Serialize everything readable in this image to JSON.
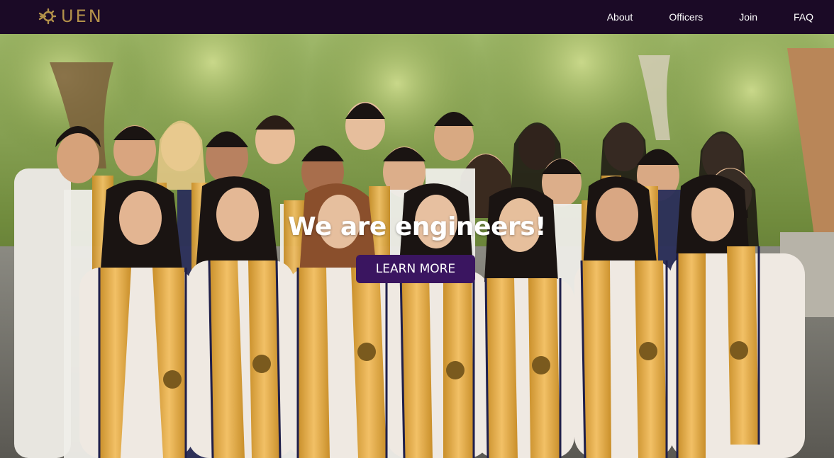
{
  "brand": {
    "logo_icon": "uen-gear-arrow-icon",
    "name": "UEN",
    "color": "#b3914a"
  },
  "nav": {
    "background": "#1b0a26",
    "items": [
      {
        "label": "About"
      },
      {
        "label": "Officers"
      },
      {
        "label": "Join"
      },
      {
        "label": "FAQ"
      }
    ]
  },
  "hero": {
    "image_description_icon": "group-photo",
    "headline_regular": "We are ",
    "headline_bold": "engineers!",
    "cta_label": "LEARN MORE",
    "cta_color": "#3a1560"
  }
}
